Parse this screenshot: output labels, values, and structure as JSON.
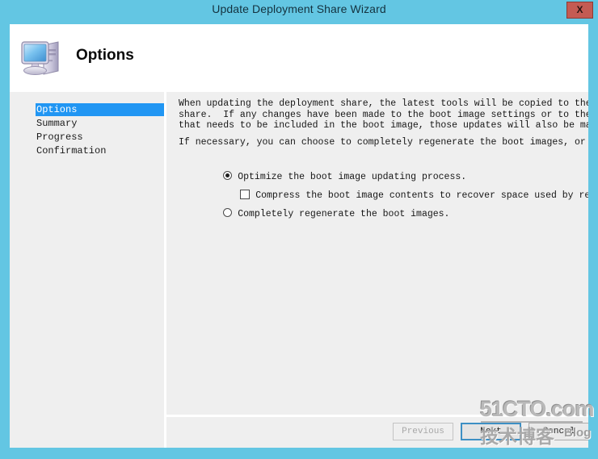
{
  "window": {
    "title": "Update Deployment Share Wizard",
    "close_label": "X",
    "titlebar_color": "#63c6e3",
    "frame_color": "#63c6e3"
  },
  "header": {
    "heading": "Options",
    "icon": "computer-icon"
  },
  "sidebar": {
    "items": [
      {
        "label": "Options",
        "active": true
      },
      {
        "label": "Summary",
        "active": false
      },
      {
        "label": "Progress",
        "active": false
      },
      {
        "label": "Confirmation",
        "active": false
      }
    ],
    "active_color": "#2196f3"
  },
  "content": {
    "paragraph1": "When updating the deployment share, the latest tools will be copied to the deployment\nshare.  If any changes have been made to the boot image settings or to the content\nthat needs to be included in the boot image, those updates will also be made.",
    "paragraph2": "If necessary, you can choose to completely regenerate the boot images, or to compress",
    "options": [
      {
        "type": "radio",
        "label": "Optimize the boot image updating process.",
        "checked": true
      },
      {
        "type": "checkbox",
        "label": "Compress the boot image contents to recover space used by removed or modified co",
        "checked": false
      },
      {
        "type": "radio",
        "label": "Completely regenerate the boot images.",
        "checked": false
      }
    ]
  },
  "footer": {
    "previous_label": "Previous",
    "previous_enabled": false,
    "next_label": "Next",
    "next_focused": true,
    "cancel_label": "Cancel"
  },
  "watermark": {
    "main": "51CTO.com",
    "chinese": "技术博客",
    "blog": "Blog"
  }
}
